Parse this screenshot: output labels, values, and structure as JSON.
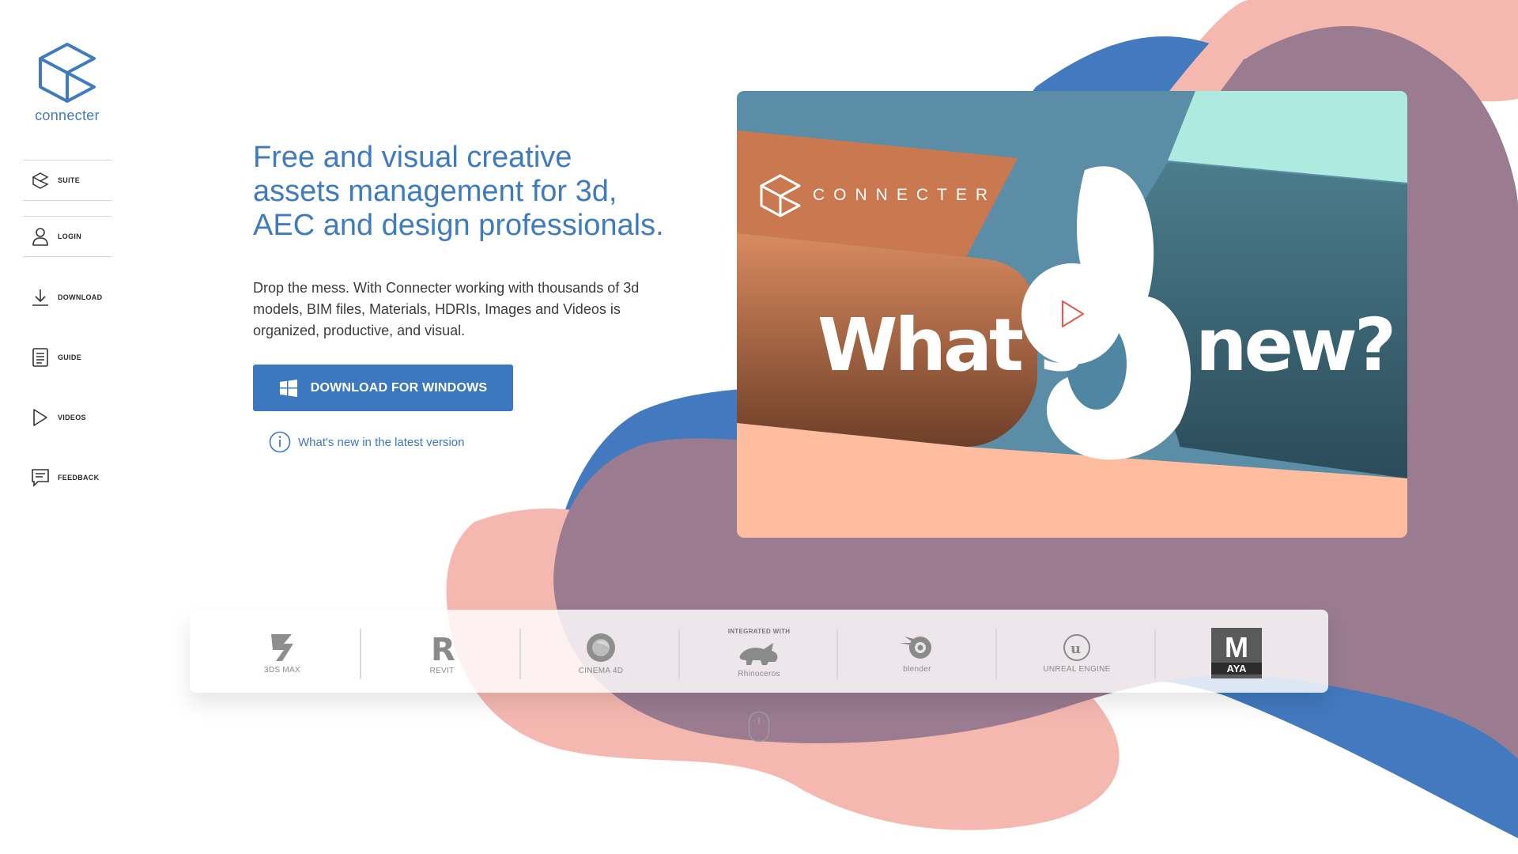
{
  "brand": {
    "name": "connecter",
    "video_brand": "CONNECTER"
  },
  "sidebar": {
    "items": [
      {
        "label": "SUITE",
        "icon": "cube-icon"
      },
      {
        "label": "LOGIN",
        "icon": "user-icon"
      },
      {
        "label": "DOWNLOAD",
        "icon": "download-icon"
      },
      {
        "label": "GUIDE",
        "icon": "document-icon"
      },
      {
        "label": "VIDEOS",
        "icon": "play-icon"
      },
      {
        "label": "FEEDBACK",
        "icon": "chat-icon"
      }
    ]
  },
  "hero": {
    "headline": "Free and visual creative assets management for 3d, AEC and design professionals.",
    "description": "Drop the mess. With Connecter working with thousands of 3d models, BIM files, Materials, HDRIs, Images and Videos is organized, productive, and visual.",
    "download_label": "DOWNLOAD FOR WINDOWS",
    "whatsnew_label": "What's new in the latest version"
  },
  "video": {
    "title_left": "What's",
    "title_right": "new?"
  },
  "integrations": {
    "heading": "INTEGRATED WITH",
    "items": [
      {
        "label": "3DS MAX",
        "icon": "3dsmax-icon"
      },
      {
        "label": "REVIT",
        "icon": "revit-icon"
      },
      {
        "label": "CINEMA 4D",
        "icon": "cinema4d-icon"
      },
      {
        "label": "Rhinoceros",
        "icon": "rhinoceros-icon"
      },
      {
        "label": "blender",
        "icon": "blender-icon"
      },
      {
        "label": "UNREAL ENGINE",
        "icon": "unreal-engine-icon"
      },
      {
        "label": "AYA",
        "icon": "maya-icon"
      }
    ]
  },
  "colors": {
    "brand_blue": "#3e7bbf",
    "blob_pink": "#f5b8b1",
    "blob_blue": "#4279bf",
    "blob_purple": "#9a7b90",
    "video_peach": "#fdbd9e"
  }
}
